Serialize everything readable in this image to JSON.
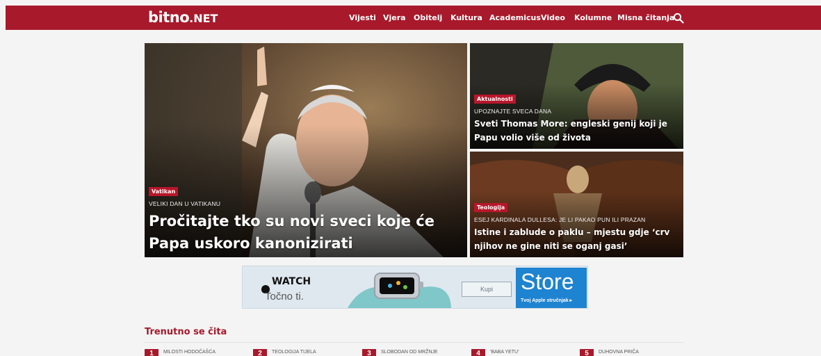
{
  "site": {
    "logo": "bitno",
    "logo_suffix": ".NET"
  },
  "nav": {
    "items": [
      {
        "label": "Vijesti"
      },
      {
        "label": "Vjera"
      },
      {
        "label": "Obitelj"
      },
      {
        "label": "Kultura"
      },
      {
        "label": "Academicus"
      },
      {
        "label": "Video"
      },
      {
        "label": "Kolumne"
      },
      {
        "label": "Misna čitanja"
      }
    ],
    "search_icon": "search-icon"
  },
  "featured": {
    "main": {
      "category": "Vatikan",
      "kicker": "VELIKI DAN U VATIKANU",
      "title": "Pročitajte tko su novi sveci koje će Papa uskoro kanonizirati"
    },
    "side": [
      {
        "category": "Aktualnosti",
        "kicker": "UPOZNAJTE SVECA DANA",
        "title": "Sveti Thomas More: engleski genij koji je Papu volio više od života"
      },
      {
        "category": "Teologija",
        "kicker": "ESEJ KARDINALA DULLESA: JE LI PAKAO PUN ILI PRAZAN",
        "title": "Istine i zablude o paklu – mjestu gdje ‘crv njihov ne gine niti se oganj gasi’"
      }
    ]
  },
  "ad": {
    "brand": "WATCH",
    "tagline": "Točno ti.",
    "button": "Kupi",
    "store_title": "Store",
    "store_subtitle": "Tvoj Apple stručnjak ▸",
    "choices": "▷X"
  },
  "trending": {
    "title": "Trenutno se čita",
    "items": [
      {
        "num": "1",
        "label": "MILOSTI HODOČAŠĆA"
      },
      {
        "num": "2",
        "label": "TEOLOGIJA TIJELA"
      },
      {
        "num": "3",
        "label": "SLOBODAN OD MRŽNJE"
      },
      {
        "num": "4",
        "label": "'BABA YETU'"
      },
      {
        "num": "5",
        "label": "DUHOVNA PRIČA"
      }
    ]
  },
  "colors": {
    "brand": "#a8192b",
    "badge": "#b8162b",
    "store": "#1e83d0"
  }
}
